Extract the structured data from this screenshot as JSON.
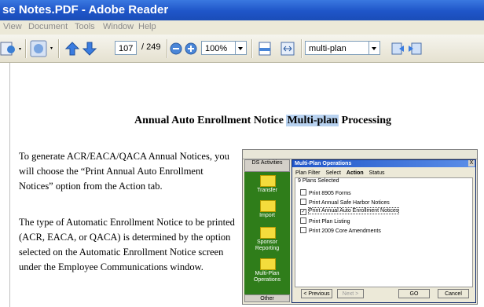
{
  "window": {
    "title": "se Notes.PDF - Adobe Reader"
  },
  "menu": [
    "View",
    "Document",
    "Tools",
    "Window",
    "Help"
  ],
  "toolbar": {
    "page_current": "107",
    "page_total": "/ 249",
    "zoom": "100%",
    "search_value": "multi-plan"
  },
  "document": {
    "heading_pre": "Annual Auto Enrollment Notice ",
    "heading_highlight": "Multi-plan",
    "heading_post": " Processing",
    "paragraphs": [
      "To generate ACR/EACA/QACA Annual Notices, you will choose the “Print Annual Auto Enrollment Notices” option from the Action tab.",
      "The type of Automatic Enrollment Notice to be printed (ACR, EACA, or QACA) is determined by the option selected on the Automatic Enrollment Notice screen under the Employee Communications window."
    ]
  },
  "embedded": {
    "sidebar_top": "DS Activities",
    "sidebar_items": [
      "Transfer",
      "Import",
      "Sponsor Reporting",
      "Multi-Plan Operations"
    ],
    "sidebar_bottom": "Other",
    "dialog_title": "Multi-Plan Operations",
    "close": "X",
    "tabs": [
      "Plan Filter",
      "Select",
      "Action",
      "Status"
    ],
    "selected_count": "9 Plans Selected",
    "options": [
      {
        "label": "Print 8905 Forms",
        "checked": false
      },
      {
        "label": "Print Annual Safe Harbor Notices",
        "checked": false
      },
      {
        "label": "Print Annual Auto Enrollment Notices",
        "checked": true
      },
      {
        "label": "Print Plan Listing",
        "checked": false
      },
      {
        "label": "Print 2009 Core Amendments",
        "checked": false
      }
    ],
    "buttons": [
      "< Previous",
      "Next >",
      "GO",
      "Cancel"
    ]
  }
}
